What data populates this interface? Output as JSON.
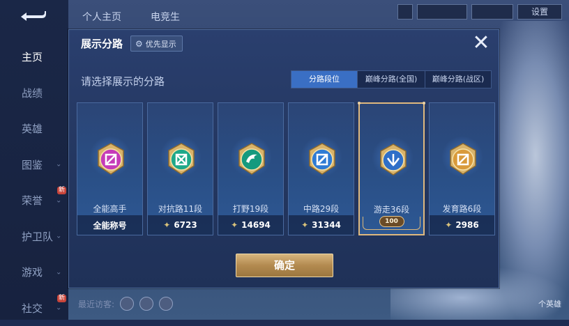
{
  "background": {
    "top_tabs": [
      "个人主页",
      "电竞生"
    ],
    "settings_label": "设置",
    "side_nav": [
      {
        "label": "主页",
        "active": true,
        "chevron": false,
        "badge": ""
      },
      {
        "label": "战绩",
        "active": false,
        "chevron": false,
        "badge": ""
      },
      {
        "label": "英雄",
        "active": false,
        "chevron": false,
        "badge": ""
      },
      {
        "label": "图鉴",
        "active": false,
        "chevron": true,
        "badge": ""
      },
      {
        "label": "荣誉",
        "active": false,
        "chevron": true,
        "badge": "新"
      },
      {
        "label": "护卫队",
        "active": false,
        "chevron": true,
        "badge": ""
      },
      {
        "label": "游戏",
        "active": false,
        "chevron": true,
        "badge": ""
      },
      {
        "label": "社交",
        "active": false,
        "chevron": true,
        "badge": "新"
      }
    ],
    "recent_visitors_label": "最近访客:",
    "bottom_right_label": "个英雄"
  },
  "modal": {
    "title": "展示分路",
    "priority_label": "优先显示",
    "close_symbol": "✕",
    "subtitle": "请选择展示的分路",
    "tabs": [
      {
        "label": "分路段位",
        "active": true
      },
      {
        "label": "巅峰分路(全国)",
        "active": false
      },
      {
        "label": "巅峰分路(战区)",
        "active": false
      }
    ],
    "cards": [
      {
        "name": "全能高手",
        "footer": "全能称号",
        "has_gem": false,
        "selected": false,
        "badge_color": "#c53bb8",
        "icon": "all-round-icon"
      },
      {
        "name": "对抗路11段",
        "footer": "6723",
        "has_gem": true,
        "selected": false,
        "badge_color": "#1ea889",
        "icon": "clash-lane-icon"
      },
      {
        "name": "打野19段",
        "footer": "14694",
        "has_gem": true,
        "selected": false,
        "badge_color": "#159a7e",
        "icon": "jungle-icon"
      },
      {
        "name": "中路29段",
        "footer": "31344",
        "has_gem": true,
        "selected": false,
        "badge_color": "#2f7bd4",
        "icon": "mid-lane-icon"
      },
      {
        "name": "游走36段",
        "footer": "",
        "level_tag": "100",
        "has_gem": false,
        "selected": true,
        "badge_color": "#2f6fc8",
        "icon": "roam-icon"
      },
      {
        "name": "发育路6段",
        "footer": "2986",
        "has_gem": true,
        "selected": false,
        "badge_color": "#d99a3a",
        "icon": "farm-lane-icon"
      }
    ],
    "confirm_label": "确定"
  }
}
